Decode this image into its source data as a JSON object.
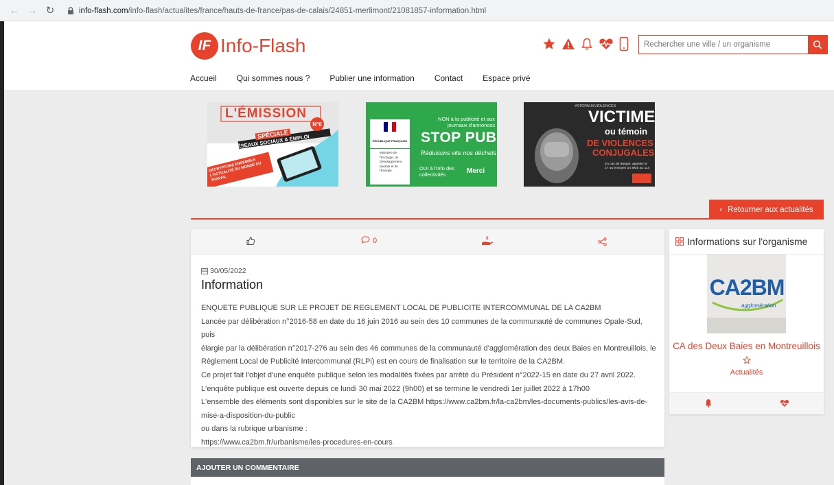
{
  "browser": {
    "url_domain": "info-flash.com",
    "url_path": "/info-flash/actualites/france/hauts-de-france/pas-de-calais/24851-merlimont/21081857-information.html"
  },
  "header": {
    "logo_badge": "IF",
    "logo_text": "Info-Flash",
    "search_placeholder": "Rechercher une ville / un organisme",
    "menu": [
      "Accueil",
      "Qui sommes nous ?",
      "Publier une information",
      "Contact",
      "Espace privé"
    ],
    "icons": [
      "star-icon",
      "warning-icon",
      "bell-icon",
      "heartbeat-icon",
      "mobile-icon"
    ]
  },
  "banners": {
    "b1": {
      "line1": "L'ÉMISSION",
      "badge": "N°6",
      "line2": "SPÉCIALE",
      "line3": "RÉSEAUX SOCIAUX & EMPLOI",
      "line4": "DÉCRYPTONS ENSEMBLE L'ACTUALITÉ DU MONDE DU TRAVAIL"
    },
    "b2": {
      "top": "NON à la publicité et aux journaux d'annonces",
      "logo": "RÉPUBLIQUE FRANÇAISE",
      "ministry": "Ministère de l'Écologie, du Développement durable et de l'Énergie",
      "title": "STOP PUB",
      "slogan": "Réduisons vite nos déchets !",
      "info": "OUI à l'info des collectivités",
      "merci": "Merci"
    },
    "b3": {
      "tag": "#STOPAUXVIOLENCES",
      "title": "VICTIME",
      "sub": "ou témoin",
      "red1": "DE VIOLENCES",
      "red2": "CONJUGALES ?",
      "note": "En cas de danger, appelez le 17 ou envoyez un SMS au 114"
    }
  },
  "back_button": "Retourner aux actualités",
  "article": {
    "comments_count": "0",
    "date": "30/05/2022",
    "title": "Information",
    "lines": [
      "ENQUETE PUBLIQUE SUR LE PROJET DE REGLEMENT LOCAL DE PUBLICITE INTERCOMMUNAL DE LA CA2BM",
      "Lancée par délibération n°2016-58 en date du 16 juin 2016 au sein des 10 communes de la communauté de communes Opale-Sud, puis",
      "élargie par la délibération n°2017-276 au sein des 46 communes de la communauté d'agglomération des deux Baies en Montreuillois, le",
      "Règlement Local de Publicité Intercommunal (RLPi) est en cours de finalisation sur le territoire de la CA2BM.",
      "Ce projet fait l'objet d'une enquête publique selon les modalités fixées par arrêté du Président n°2022-15 en date du 27 avril 2022.",
      "L'enquête publique est ouverte depuis ce lundi 30 mai 2022 (9h00) et se termine le vendredi 1er juillet 2022 à 17h00",
      "L'ensemble des éléments sont disponibles sur le site de la CA2BM https://www.ca2bm.fr/la-ca2bm/les-documents-publics/les-avis-de-",
      "mise-a-disposition-du-public",
      "ou dans la rubrique urbanisme :",
      "https://www.ca2bm.fr/urbanisme/les-procedures-en-cours"
    ]
  },
  "comment": {
    "header": "AJOUTER UN COMMENTAIRE"
  },
  "org": {
    "header": "Informations sur l'organisme",
    "logo_text": "CA2BM",
    "logo_sub": "agglomération",
    "name": "CA des Deux Baies en Montreuillois",
    "actualites": "Actualités"
  },
  "colors": {
    "accent": "#e7432c",
    "comment_header": "#5f6367"
  }
}
